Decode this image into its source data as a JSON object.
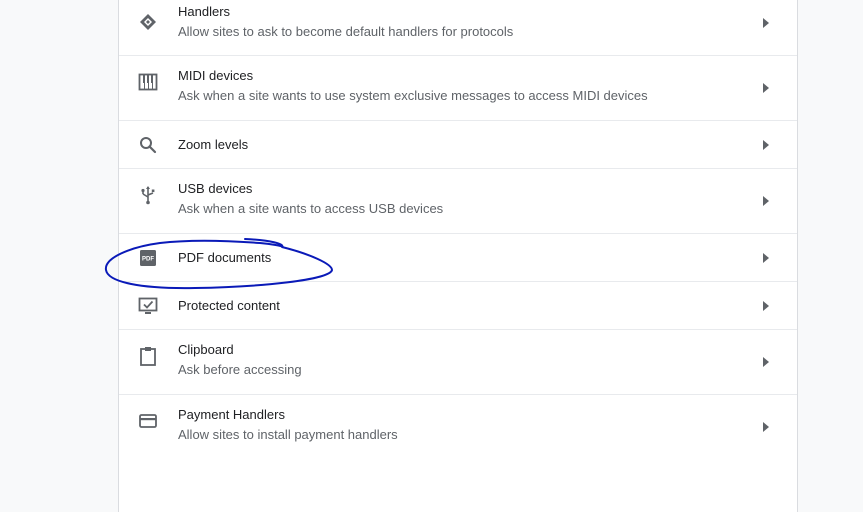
{
  "rows": [
    {
      "id": "handlers",
      "title": "Handlers",
      "subtitle": "Allow sites to ask to become default handlers for protocols",
      "icon": "handlers-icon"
    },
    {
      "id": "midi-devices",
      "title": "MIDI devices",
      "subtitle": "Ask when a site wants to use system exclusive messages to access MIDI devices",
      "icon": "piano-icon"
    },
    {
      "id": "zoom-levels",
      "title": "Zoom levels",
      "subtitle": "",
      "icon": "search-icon"
    },
    {
      "id": "usb-devices",
      "title": "USB devices",
      "subtitle": "Ask when a site wants to access USB devices",
      "icon": "usb-icon"
    },
    {
      "id": "pdf-documents",
      "title": "PDF documents",
      "subtitle": "",
      "icon": "pdf-icon"
    },
    {
      "id": "protected-content",
      "title": "Protected content",
      "subtitle": "",
      "icon": "protected-content-icon"
    },
    {
      "id": "clipboard",
      "title": "Clipboard",
      "subtitle": "Ask before accessing",
      "icon": "clipboard-icon"
    },
    {
      "id": "payment-handlers",
      "title": "Payment Handlers",
      "subtitle": "Allow sites to install payment handlers",
      "icon": "credit-card-icon"
    }
  ],
  "pdf_icon_text": "PDF",
  "colors": {
    "icon": "#5f6368",
    "title": "#202124",
    "subtitle": "#5f6368",
    "divider": "#e8eaed",
    "annotation": "#0a1ab8"
  }
}
